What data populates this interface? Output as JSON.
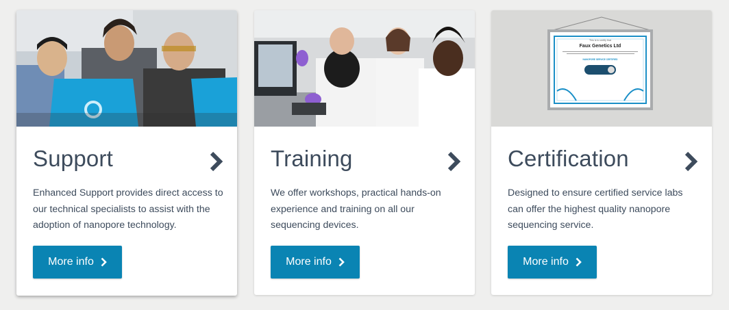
{
  "cards": [
    {
      "title": "Support",
      "description": "Enhanced Support provides direct access to our technical specialists to assist with the adoption of nanopore technology.",
      "button_label": "More info"
    },
    {
      "title": "Training",
      "description": "We offer workshops, practical hands-on experience and training on all our sequencing devices.",
      "button_label": "More info"
    },
    {
      "title": "Certification",
      "description": "Designed to ensure certified service labs can offer the highest quality nanopore sequencing service.",
      "button_label": "More info"
    }
  ],
  "certificate": {
    "intro": "This is to certify that",
    "company": "Faux Genetics Ltd",
    "badge": "NANOPORE SERVICE CERTIFIED"
  },
  "colors": {
    "button": "#0a84b3",
    "heading": "#3d4b5c",
    "page_background": "#efefee"
  }
}
